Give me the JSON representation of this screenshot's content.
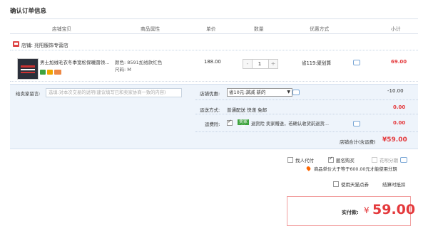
{
  "page": {
    "title": "确认订单信息"
  },
  "columns": [
    "店铺宝贝",
    "商品属性",
    "单价",
    "数量",
    "优惠方式",
    "小计"
  ],
  "shop": {
    "label": "店铺: 兆阳服饰专营店"
  },
  "item": {
    "name": "男士加绒毛衣冬季宽松保暖圆领…",
    "color": "颜色: 8591加绒款红色",
    "size": "尺码: M",
    "price": "188.00",
    "qty": "1",
    "minus": "-",
    "plus": "+",
    "promo": "省119:聚划算",
    "subtotal": "69.00"
  },
  "memo": {
    "label": "给卖家留言:",
    "placeholder": "选填:对本次交易的说明(建议填写已和卖家协商一致的内容)"
  },
  "shop_discount": {
    "label": "店铺优惠:",
    "selected": "省10元:满减 新的",
    "value": "-10.00"
  },
  "delivery": {
    "label": "运送方式:",
    "text": "普通配送 快递 免邮",
    "value": "0.00"
  },
  "insurance": {
    "label": "运费险:",
    "tag": "卖家送",
    "text": "退货险 卖家赠送，若确认收货前退货…",
    "value": "0.00"
  },
  "shop_total": {
    "label": "店铺合计(含运费)",
    "value": "¥59.00"
  },
  "options": {
    "proxy": "找人代付",
    "anonymous": "匿名购买",
    "huabei": "花呗分期"
  },
  "location_note": "商品单价大于等于600.00元才能使用分期",
  "tmall_points": {
    "label": "使用天猫点券",
    "link": "结算时抵扣"
  },
  "payment": {
    "label": "实付款:",
    "currency": "¥",
    "value": "59.00"
  },
  "colors": {
    "accent": "#e4393c",
    "panel": "#eef4fb",
    "green": "#3ea33e"
  }
}
